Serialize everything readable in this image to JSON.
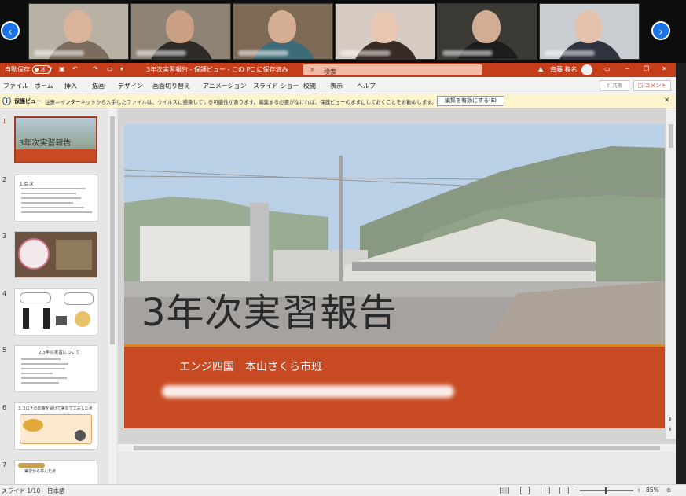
{
  "window": {
    "title": "3年次実習報告 - 保護ビュー - この PC に保存済み",
    "autosave_label": "自動保存",
    "autosave_state": "オフ",
    "search_placeholder": "検索",
    "user_name": "斉藤 稜名"
  },
  "menu": {
    "items": [
      "ファイル",
      "ホーム",
      "挿入",
      "描画",
      "デザイン",
      "画面切り替え",
      "アニメーション",
      "スライド ショー",
      "校閲",
      "表示",
      "ヘルプ"
    ],
    "share_label": "共有",
    "comment_label": "コメント"
  },
  "protected_view": {
    "label": "保護ビュー",
    "message": "注意—インターネットから入手したファイルは、ウイルスに感染している可能性があります。編集する必要がなければ、保護ビューのままにしておくことをお勧めします。",
    "enable_button": "編集を有効にする(E)"
  },
  "thumbnails": [
    {
      "number": "1",
      "title": "3年次実習報告"
    },
    {
      "number": "2",
      "title": "1.目次"
    },
    {
      "number": "3",
      "title": ""
    },
    {
      "number": "4",
      "title": ""
    },
    {
      "number": "5",
      "title": "2.3年の実習について"
    },
    {
      "number": "6",
      "title": "3.コロナの影響を受けて実習で工夫した点"
    },
    {
      "number": "7",
      "title": "実習から学んだ点"
    }
  ],
  "slide": {
    "title": "3年次実習報告",
    "subtitle": "エンジ四国　本山さくら市班"
  },
  "status": {
    "slide_indicator": "スライド 1/10",
    "language": "日本語",
    "zoom": "85%"
  },
  "colors": {
    "accent": "#c43e1c",
    "slide_band": "#c84a22"
  }
}
